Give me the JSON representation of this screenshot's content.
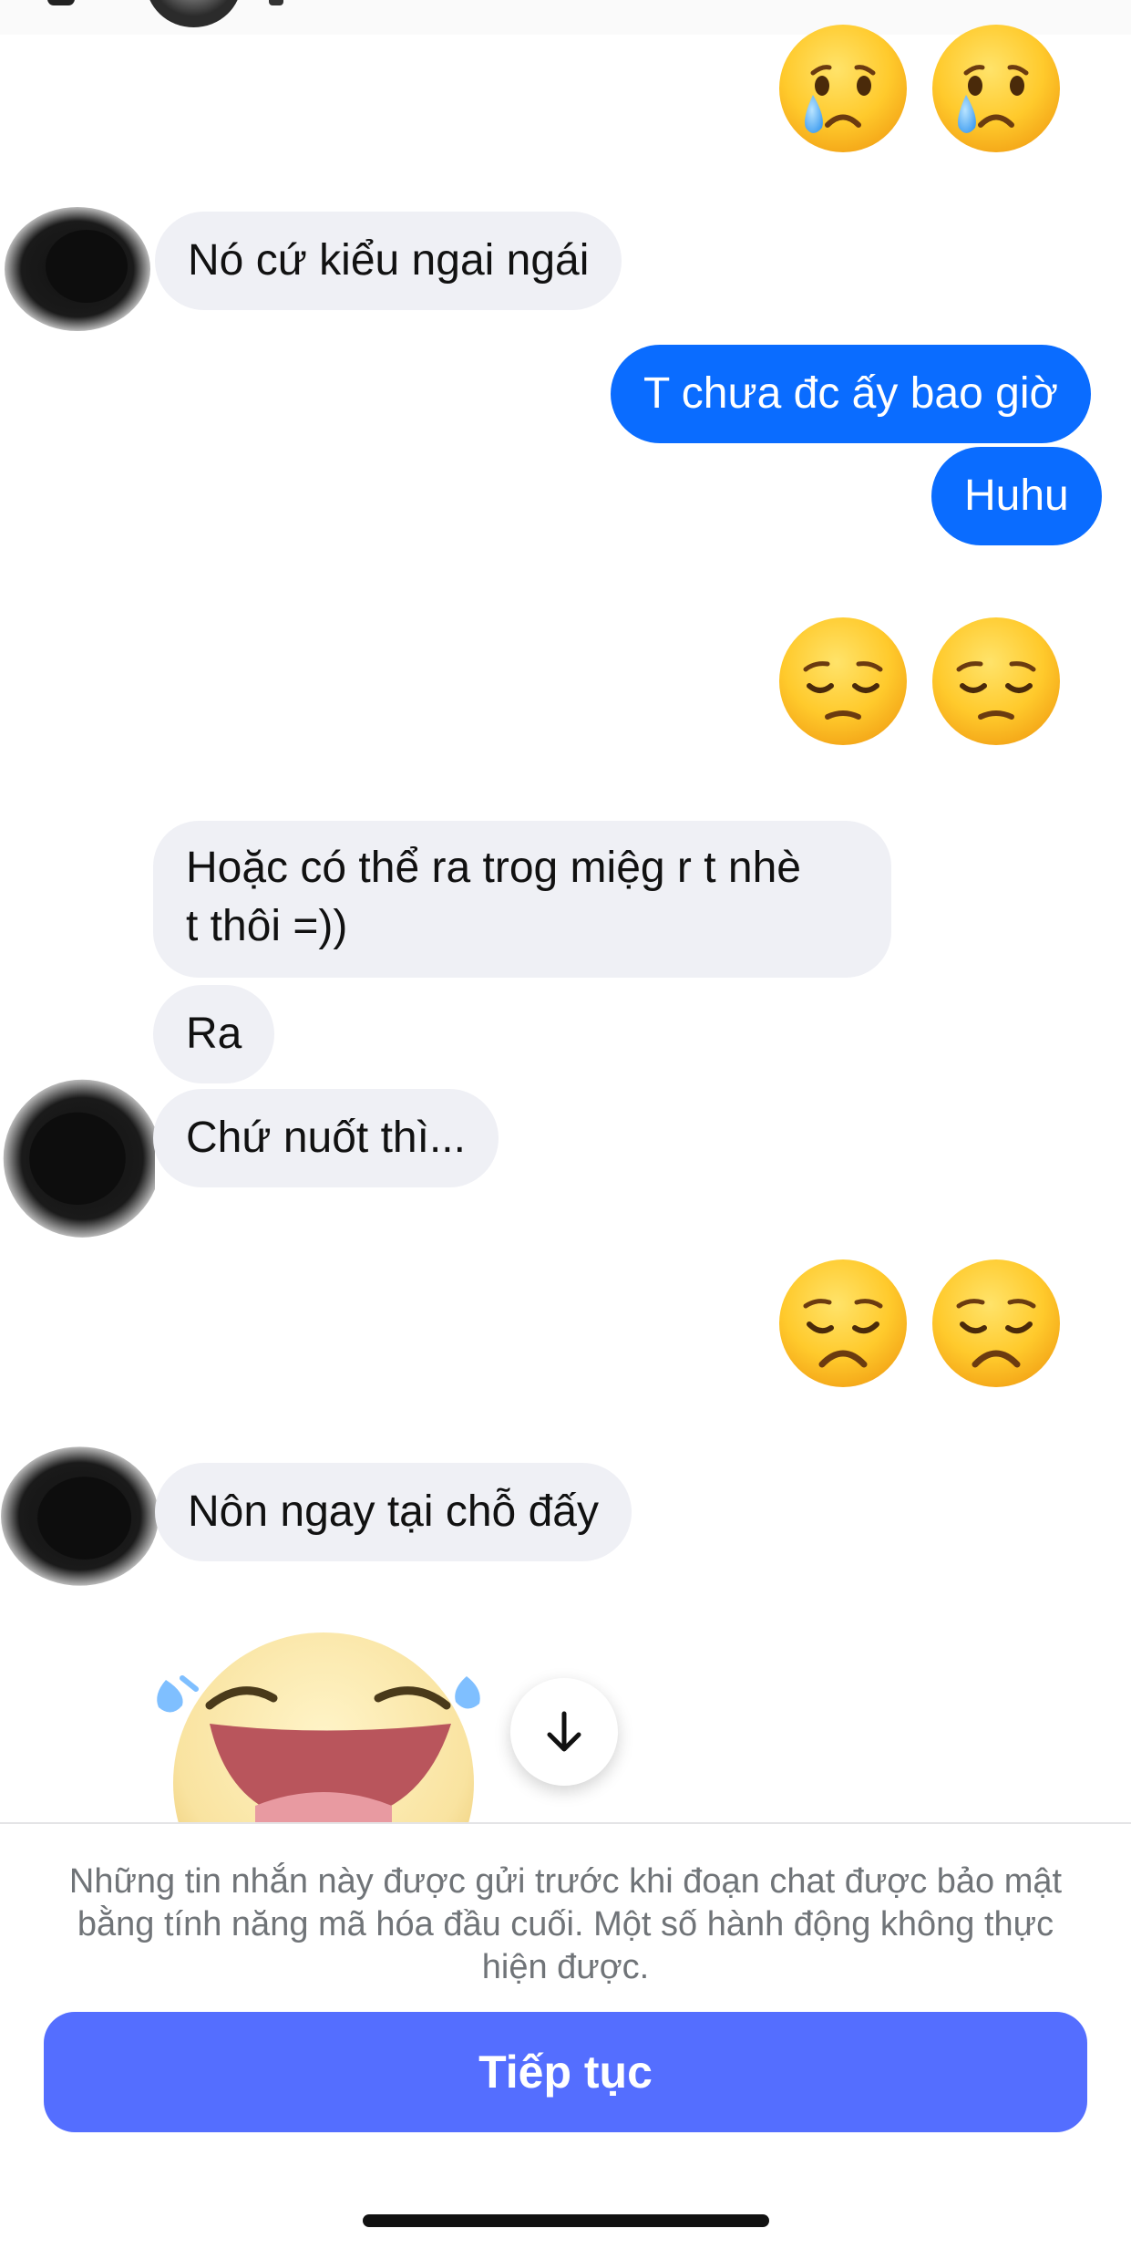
{
  "messages": [
    {
      "id": "m1",
      "side": "in",
      "text": "Nó cứ kiểu ngai ngái"
    },
    {
      "id": "m2",
      "side": "out",
      "text": "T chưa đc ấy bao giờ"
    },
    {
      "id": "m3",
      "side": "out",
      "text": "Huhu"
    },
    {
      "id": "m4",
      "side": "in",
      "lines": [
        "Hoặc có thể ra trog miệg r t nhè",
        "t thôi =))"
      ]
    },
    {
      "id": "m5",
      "side": "in",
      "text": "Ra"
    },
    {
      "id": "m6",
      "side": "in",
      "text": "Chứ nuốt thì..."
    },
    {
      "id": "m7",
      "side": "in",
      "text": "Nôn ngay tại chỗ đấy"
    }
  ],
  "emoji_messages": [
    {
      "side": "out",
      "emoji": "crying-face",
      "count": 2
    },
    {
      "side": "out",
      "emoji": "pensive-face",
      "count": 2
    },
    {
      "side": "out",
      "emoji": "disappointed-face",
      "count": 2
    },
    {
      "side": "in",
      "emoji": "laughing-tears-sticker",
      "count": 1
    }
  ],
  "footer": {
    "notice": "Những tin nhắn này được gửi trước khi đoạn chat được bảo mật bằng tính năng mã hóa đầu cuối. Một số hành động không thực hiện được.",
    "continue_label": "Tiếp tục"
  },
  "icons": {
    "scroll_down": "arrow-down-icon"
  },
  "colors": {
    "outgoing_bubble": "#0a6cff",
    "incoming_bubble": "#eff0f5",
    "continue_button": "#546eff",
    "notice_text": "#707478"
  }
}
